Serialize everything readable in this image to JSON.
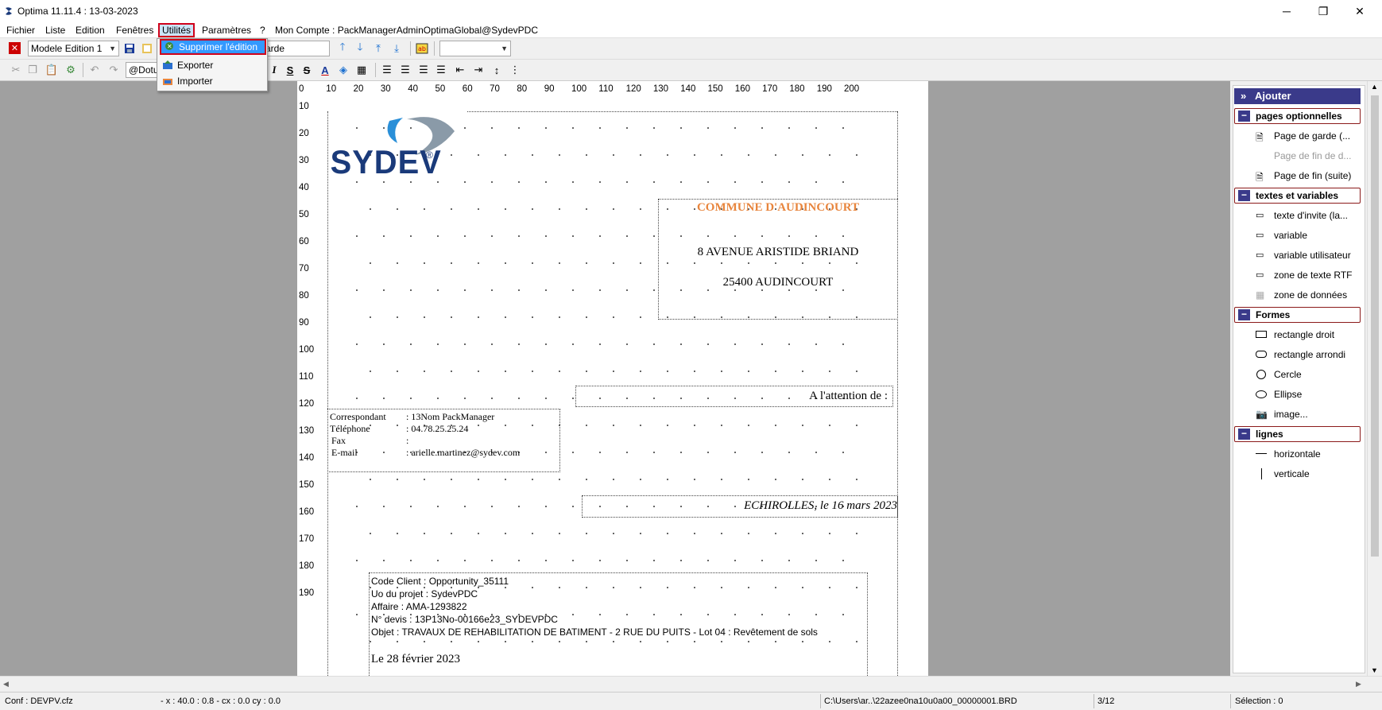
{
  "window": {
    "title": "Optima 11.11.4 : 13-03-2023",
    "minimize": "─",
    "maximize": "❐",
    "close": "✕"
  },
  "menu": {
    "items": [
      "Fichier",
      "Liste",
      "Edition",
      "Fenêtres",
      "Utilités",
      "Paramètres",
      "?",
      "Mon Compte : PackManagerAdminOptimaGlobal@SydevPDC"
    ]
  },
  "dropdown": {
    "items": [
      "Supprimer l'édition",
      "Exporter",
      "Importer"
    ]
  },
  "toolbar": {
    "model_combo": "Modele Edition 1",
    "page_combo_partial": "arde",
    "field_combo_partial": "@Dotu",
    "empty_combo": ""
  },
  "ruler": {
    "horizontal": [
      "0",
      "10",
      "20",
      "30",
      "40",
      "50",
      "60",
      "70",
      "80",
      "90",
      "100",
      "110",
      "120",
      "130",
      "140",
      "150",
      "160",
      "170",
      "180",
      "190",
      "200"
    ],
    "vertical": [
      "10",
      "20",
      "30",
      "40",
      "50",
      "60",
      "70",
      "80",
      "90",
      "100",
      "110",
      "120",
      "130",
      "140",
      "150",
      "160",
      "170",
      "180",
      "190"
    ]
  },
  "document": {
    "logo_text": "SYDEV",
    "logo_mark": "®",
    "recipient_name": "COMMUNE D'AUDINCOURT",
    "recipient_address1": "8 AVENUE ARISTIDE BRIAND",
    "recipient_address2": "25400 AUDINCOURT",
    "attention": "A l'attention de :",
    "contact": {
      "labels": [
        "Correspondant",
        "Téléphone",
        "Fax",
        "E-mail"
      ],
      "values": [
        ": 13Nom PackManager",
        ": 04.78.25.25.24",
        ":",
        ": arielle.martinez@sydev.com"
      ]
    },
    "place_date": "ECHIROLLES, le 16 mars 2023",
    "info_lines": [
      "Code Client : Opportunity_35111",
      "Uo du projet : SydevPDC",
      "Affaire :  AMA-1293822",
      "N° devis : 13P13No-00166e23_SYDEVPDC",
      "Objet : TRAVAUX DE REHABILITATION DE BATIMENT - 2 RUE DU PUITS - Lot 04 : Revêtement de sols"
    ],
    "letter_date": "Le 28 février 2023"
  },
  "panel": {
    "add": "Ajouter",
    "sections": [
      {
        "title": "pages optionnelles",
        "items": [
          "Page de garde (...",
          "Page de fin de d...",
          "Page de fin (suite)"
        ]
      },
      {
        "title": "textes et variables",
        "items": [
          "texte d'invite (la...",
          "variable",
          "variable utilisateur",
          "zone de texte RTF",
          "zone de données"
        ]
      },
      {
        "title": "Formes",
        "items": [
          "rectangle droit",
          "rectangle arrondi",
          "Cercle",
          "Ellipse",
          "image..."
        ]
      },
      {
        "title": "lignes",
        "items": [
          "horizontale",
          "verticale"
        ]
      }
    ]
  },
  "status": {
    "conf": "Conf : DEVPV.cfz",
    "coords": "- x :  40.0 :   0.8 - cx :   0.0 cy :   0.0",
    "path": "C:\\Users\\ar..\\22azee0na10u0a00_00000001.BRD",
    "page": "3/12",
    "selection": "Sélection : 0"
  },
  "colors": {
    "accent_red": "#d0021b",
    "panel_header": "#3a3a8a",
    "recipient_orange": "#e8853d",
    "logo_blue": "#1a3a7a"
  }
}
